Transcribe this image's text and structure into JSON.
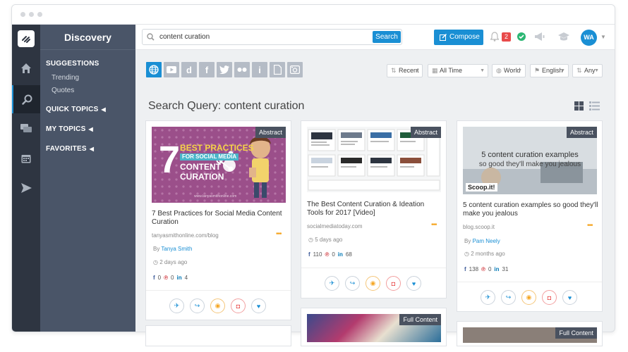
{
  "app": {
    "section_title": "Discovery"
  },
  "nav": {
    "suggestions": "SUGGESTIONS",
    "suggestion_items": [
      "Trending",
      "Quotes"
    ],
    "quick_topics": "QUICK TOPICS",
    "my_topics": "MY TOPICS",
    "favorites": "FAVORITES"
  },
  "topbar": {
    "search_value": "content curation",
    "search_button": "Search",
    "compose_label": "Compose",
    "notification_count": "2",
    "avatar_initials": "WA"
  },
  "filters": {
    "sources": [
      "globe-icon",
      "youtube-icon",
      "d-icon",
      "facebook-icon",
      "twitter-icon",
      "flickr-icon",
      "i-icon",
      "document-icon",
      "instagram-icon"
    ],
    "letters": {
      "d": "d",
      "f": "f",
      "i": "i"
    },
    "sort": "Recent",
    "time": "All Time",
    "region": "World",
    "language": "English",
    "type": "Any"
  },
  "query_heading": "Search Query: content curation",
  "cards": [
    {
      "tag": "Abstract",
      "title": "7 Best Practices for Social Media Content Curation",
      "source": "tanyasmithonline.com/blog",
      "by_label": "By",
      "author": "Tanya Smith",
      "time": "2 days ago",
      "fb": "0",
      "pin": "0",
      "li": "4",
      "thumb": {
        "big": "7",
        "line1": "BEST PRACTICES",
        "line2": "FOR SOCIAL MEDIA",
        "line3": "CONTENT",
        "line4": "CURATION",
        "url": "www.tanyasmithonline.com"
      }
    },
    {
      "tag": "Abstract",
      "title": "The Best Content Curation & Ideation Tools for 2017 [Video]",
      "source": "socialmediatoday.com",
      "time": "5 days ago",
      "fb": "110",
      "pin": "0",
      "li": "68"
    },
    {
      "tag": "Abstract",
      "title": "5 content curation examples so good they'll make you jealous",
      "source": "blog.scoop.it",
      "by_label": "By",
      "author": "Pam Neely",
      "time": "2 months ago",
      "fb": "138",
      "pin": "0",
      "li": "31",
      "thumb": {
        "line1": "5 content curation examples",
        "line2": "so good they'll make you jealous",
        "brand": "Scoop.it!"
      }
    },
    {
      "tag": "Full Content"
    },
    {
      "tag": "Full Content"
    }
  ],
  "colors": {
    "accent": "#1a8fd4",
    "sidebar": "#4a5568",
    "rail": "#2e3541"
  }
}
